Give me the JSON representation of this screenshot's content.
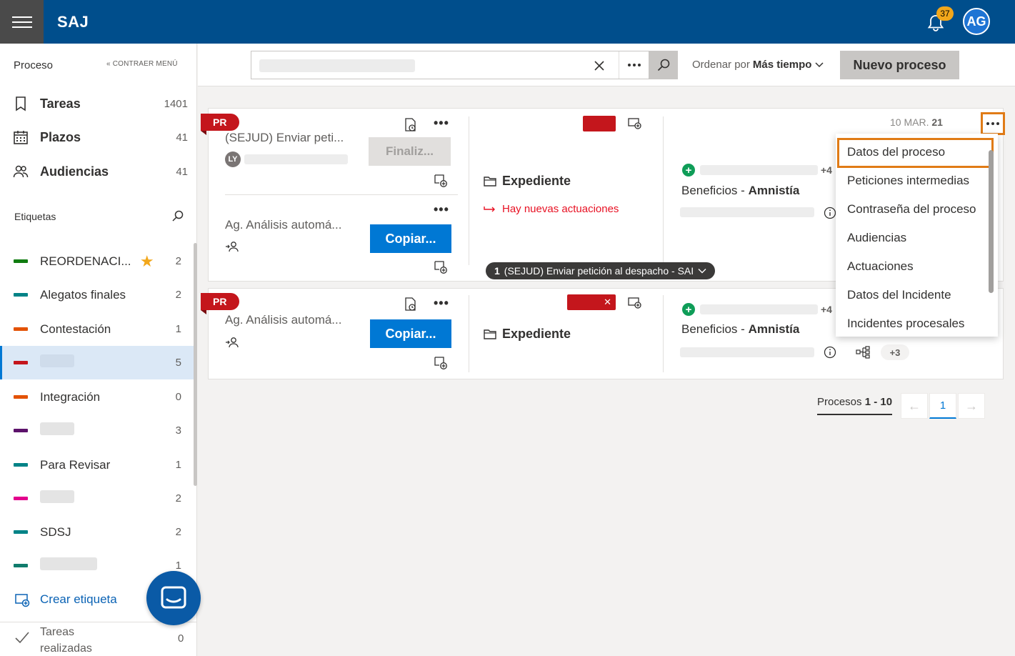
{
  "header": {
    "brand": "SAJ",
    "notification_count": "37",
    "avatar_initials": "AG",
    "brand_color": "#004e8c"
  },
  "sidebar": {
    "section_title": "Proceso",
    "collapse_label": "« CONTRAER MENÚ",
    "nav": [
      {
        "label": "Tareas",
        "count": "1401",
        "icon": "bookmark-icon"
      },
      {
        "label": "Plazos",
        "count": "41",
        "icon": "calendar-icon"
      },
      {
        "label": "Audiencias",
        "count": "41",
        "icon": "people-icon"
      }
    ],
    "tags_title": "Etiquetas",
    "tags": [
      {
        "label": "REORDENACI...",
        "count": "2",
        "color": "#107c10",
        "starred": true
      },
      {
        "label": "Alegatos finales",
        "count": "2",
        "color": "#038387"
      },
      {
        "label": "Contestación",
        "count": "1",
        "color": "#e35205"
      },
      {
        "label": "",
        "count": "5",
        "color": "#c4161c",
        "selected": true
      },
      {
        "label": "Integración",
        "count": "0",
        "color": "#e35205"
      },
      {
        "label": "",
        "count": "3",
        "color": "#5c126b"
      },
      {
        "label": "Para Revisar",
        "count": "1",
        "color": "#038387"
      },
      {
        "label": "",
        "count": "2",
        "color": "#e3008c"
      },
      {
        "label": "SDSJ",
        "count": "2",
        "color": "#038387"
      },
      {
        "label": "",
        "count": "1",
        "color": "#107c6c"
      }
    ],
    "create_tag": "Crear etiqueta",
    "done_label": "Tareas realizadas",
    "done_count": "0"
  },
  "toolbar": {
    "sort_prefix": "Ordenar por",
    "sort_value": "Más tiempo",
    "new_button": "Nuevo proceso"
  },
  "cards": [
    {
      "badge": "PR",
      "task1_title": "(SEJUD) Enviar peti...",
      "task1_avatar": "LY",
      "task1_button": "Finaliz...",
      "task2_title": "Ag. Análisis automá...",
      "task2_button": "Copiar...",
      "expediente": "Expediente",
      "alert": "Hay nuevas actuaciones",
      "more_count": "+4",
      "benef_prefix": "Beneficios -",
      "benef_bold": "Amnistía",
      "date_prefix": "10 MAR.",
      "date_year": "21",
      "pending_pill_num": "1",
      "pending_pill_text": "(SEJUD) Enviar petición al despacho - SAI"
    },
    {
      "badge": "PR",
      "task1_title": "Ag. Análisis automá...",
      "task1_button": "Copiar...",
      "expediente": "Expediente",
      "more_count": "+4",
      "benef_prefix": "Beneficios -",
      "benef_bold": "Amnistía",
      "chip": "+3"
    }
  ],
  "menu": {
    "items": [
      "Datos del proceso",
      "Peticiones intermedias",
      "Contraseña del proceso",
      "Audiencias",
      "Actuaciones",
      "Datos del Incidente",
      "Incidentes procesales"
    ],
    "highlight_color": "#e07b16"
  },
  "pagination": {
    "label_prefix": "Procesos",
    "label_range": "1 - 10",
    "current_page": "1"
  }
}
